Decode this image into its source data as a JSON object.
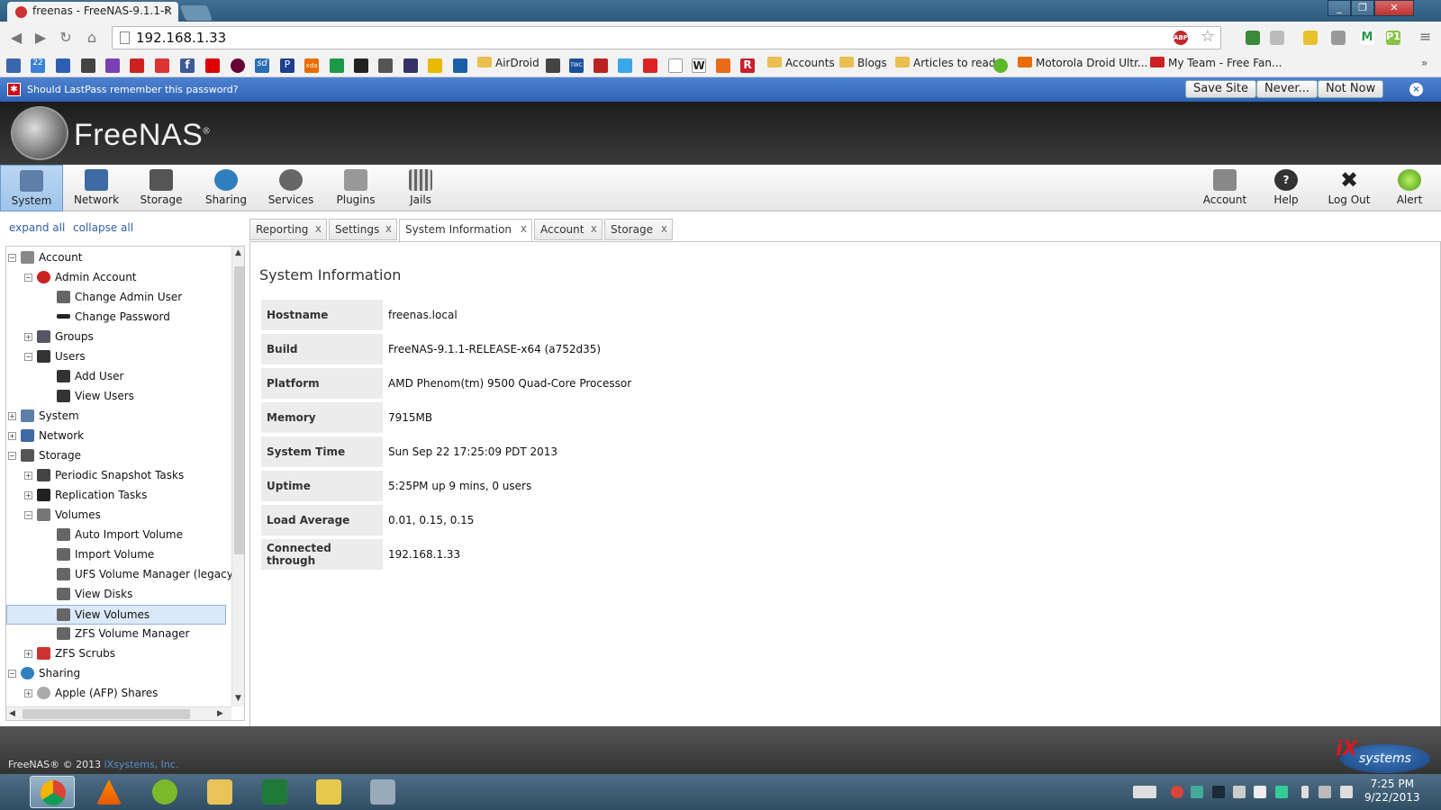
{
  "browser": {
    "tab_title": "freenas - FreeNAS-9.1.1-R",
    "tab_close": "×",
    "url": "192.168.1.33",
    "window_buttons": [
      "_",
      "❐",
      "✕"
    ],
    "adblock_label": "ABP",
    "bookmarks": [
      "AirDroid",
      "Accounts",
      "Blogs",
      "Articles to read",
      "Motorola Droid Ultr...",
      "My Team - Free Fan..."
    ],
    "bookmark_icons": [
      "sd",
      "P",
      "xda",
      "W",
      "R",
      "TWC",
      "22",
      "f"
    ]
  },
  "lastpass": {
    "message": "Should LastPass remember this password?",
    "save_site": "Save Site",
    "never": "Never...",
    "not_now": "Not Now",
    "close": "×",
    "icon": "✱"
  },
  "freenas": {
    "logo": "FreeNAS",
    "registered": "®",
    "nav_left": [
      "System",
      "Network",
      "Storage",
      "Sharing",
      "Services",
      "Plugins",
      "Jails"
    ],
    "nav_right": [
      "Account",
      "Help",
      "Log Out",
      "Alert"
    ],
    "active_nav": "System"
  },
  "tree": {
    "expand_all": "expand all",
    "collapse_all": "collapse all",
    "nodes": [
      {
        "label": "Account",
        "toggle": "−"
      },
      {
        "label": "Admin Account",
        "toggle": "−"
      },
      {
        "label": "Change Admin User",
        "toggle": ""
      },
      {
        "label": "Change Password",
        "toggle": ""
      },
      {
        "label": "Groups",
        "toggle": "+"
      },
      {
        "label": "Users",
        "toggle": "−"
      },
      {
        "label": "Add User",
        "toggle": ""
      },
      {
        "label": "View Users",
        "toggle": ""
      },
      {
        "label": "System",
        "toggle": "+"
      },
      {
        "label": "Network",
        "toggle": "+"
      },
      {
        "label": "Storage",
        "toggle": "−"
      },
      {
        "label": "Periodic Snapshot Tasks",
        "toggle": "+"
      },
      {
        "label": "Replication Tasks",
        "toggle": "+"
      },
      {
        "label": "Volumes",
        "toggle": "−"
      },
      {
        "label": "Auto Import Volume",
        "toggle": ""
      },
      {
        "label": "Import Volume",
        "toggle": ""
      },
      {
        "label": "UFS Volume Manager (legacy)",
        "toggle": ""
      },
      {
        "label": "View Disks",
        "toggle": ""
      },
      {
        "label": "View Volumes",
        "toggle": "",
        "selected": true
      },
      {
        "label": "ZFS Volume Manager",
        "toggle": ""
      },
      {
        "label": "ZFS Scrubs",
        "toggle": "+"
      },
      {
        "label": "Sharing",
        "toggle": "−"
      },
      {
        "label": "Apple (AFP) Shares",
        "toggle": "+"
      }
    ],
    "scroll_up": "▲",
    "scroll_down": "▼",
    "scroll_left": "◀",
    "scroll_right": "▶"
  },
  "tabs": [
    {
      "label": "Reporting",
      "close": "x"
    },
    {
      "label": "Settings",
      "close": "x"
    },
    {
      "label": "System Information",
      "close": "x",
      "active": true
    },
    {
      "label": "Account",
      "close": "x"
    },
    {
      "label": "Storage",
      "close": "x"
    }
  ],
  "system_info": {
    "title": "System Information",
    "rows": [
      {
        "key": "Hostname",
        "value": "freenas.local"
      },
      {
        "key": "Build",
        "value": "FreeNAS-9.1.1-RELEASE-x64 (a752d35)"
      },
      {
        "key": "Platform",
        "value": "AMD Phenom(tm) 9500 Quad-Core Processor"
      },
      {
        "key": "Memory",
        "value": "7915MB"
      },
      {
        "key": "System Time",
        "value": "Sun Sep 22 17:25:09 PDT 2013"
      },
      {
        "key": "Uptime",
        "value": "5:25PM up 9 mins, 0 users"
      },
      {
        "key": "Load Average",
        "value": "0.01, 0.15, 0.15"
      },
      {
        "key": "Connected through",
        "value": "192.168.1.33"
      }
    ]
  },
  "footer": {
    "copyright": "FreeNAS® © 2013",
    "company": "iXsystems, Inc.",
    "ix_logo": "systems",
    "ix_mark": "iX"
  },
  "taskbar": {
    "time": "7:25 PM",
    "date": "9/22/2013"
  }
}
